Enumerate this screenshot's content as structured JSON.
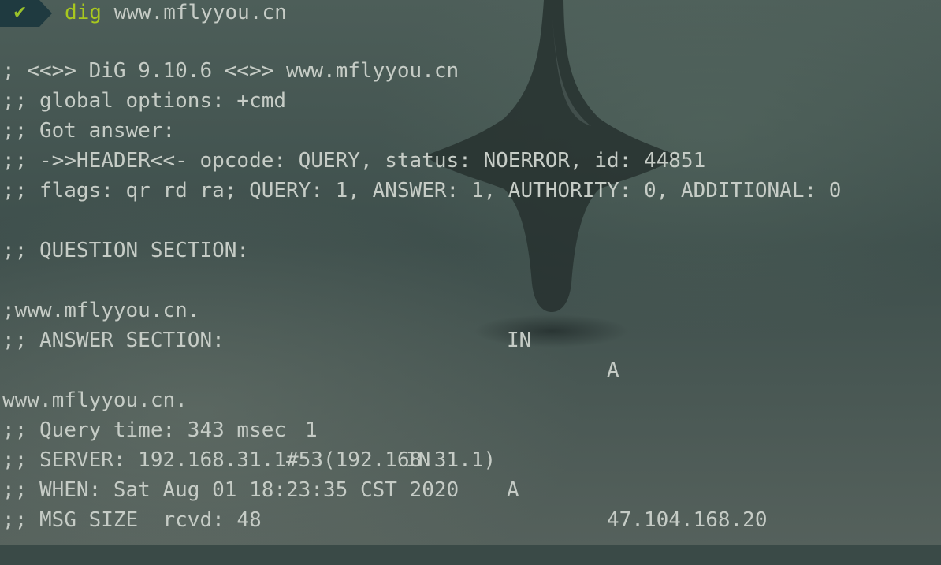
{
  "prompt": {
    "status_icon": "check-icon",
    "command": "dig",
    "argument": "www.mflyyou.cn"
  },
  "output": {
    "banner": "; <<>> DiG 9.10.6 <<>> www.mflyyou.cn",
    "global_options": ";; global options: +cmd",
    "got_answer": ";; Got answer:",
    "header": ";; ->>HEADER<<- opcode: QUERY, status: NOERROR, id: 44851",
    "flags": ";; flags: qr rd ra; QUERY: 1, ANSWER: 1, AUTHORITY: 0, ADDITIONAL: 0",
    "question_title": ";; QUESTION SECTION:",
    "question": {
      "name": ";www.mflyyou.cn.",
      "class": "IN",
      "type": "A"
    },
    "answer_title": ";; ANSWER SECTION:",
    "answer": {
      "name": "www.mflyyou.cn.",
      "ttl": "1",
      "class": "IN",
      "type": "A",
      "address": "47.104.168.20"
    },
    "query_time": ";; Query time: 343 msec",
    "server": ";; SERVER: 192.168.31.1#53(192.168.31.1)",
    "when": ";; WHEN: Sat Aug 01 18:23:35 CST 2020",
    "msg_size": ";; MSG SIZE  rcvd: 48"
  },
  "colors": {
    "badge": "#1f3a40",
    "check": "#9ac22a",
    "command": "#a8c81e",
    "text": "#c6ccc6"
  }
}
